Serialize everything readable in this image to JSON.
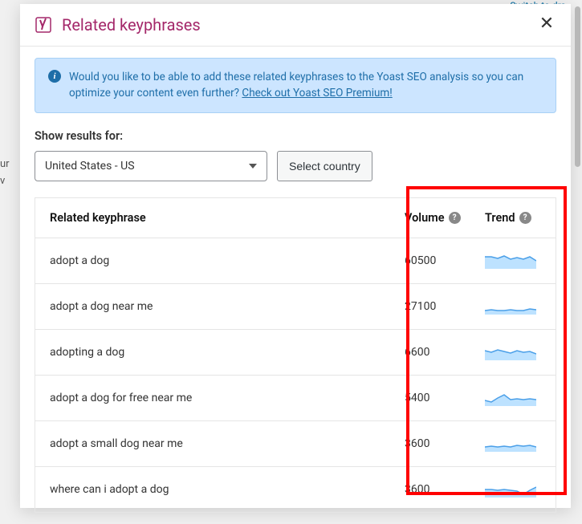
{
  "top_link": "Switch to dra",
  "modal": {
    "title": "Related keyphrases"
  },
  "banner": {
    "text": "Would you like to be able to add these related keyphrases to the Yoast SEO analysis so you can optimize your content even further? ",
    "link": "Check out Yoast SEO Premium!"
  },
  "controls": {
    "label": "Show results for:",
    "selected_country": "United States - US",
    "select_button": "Select country"
  },
  "table": {
    "headers": {
      "keyphrase": "Related keyphrase",
      "volume": "Volume",
      "trend": "Trend"
    },
    "rows": [
      {
        "key": "adopt a dog",
        "vol": "60500"
      },
      {
        "key": "adopt a dog near me",
        "vol": "27100"
      },
      {
        "key": "adopting a dog",
        "vol": "6600"
      },
      {
        "key": "adopt a dog for free near me",
        "vol": "5400"
      },
      {
        "key": "adopt a small dog near me",
        "vol": "3600"
      },
      {
        "key": "where can i adopt a dog",
        "vol": "3600"
      }
    ]
  },
  "trend_paths": [
    "M0,5 L8,5 L16,7 L24,4 L32,8 L40,6 L48,8 L56,5 L64,10",
    "M0,15 L8,14 L16,15 L24,15 L32,14 L40,15 L48,15 L56,13 L64,14",
    "M0,8 L8,10 L16,7 L24,9 L32,11 L40,8 L48,10 L56,9 L64,12",
    "M0,13 L8,15 L16,10 L24,6 L32,12 L40,11 L48,12 L56,11 L64,12",
    "M0,14 L8,13 L16,14 L24,13 L32,14 L40,12 L48,13 L56,12 L64,14",
    "M0,10 L8,10 L16,11 L24,10 L32,11 L40,12 L48,16 L56,11 L64,7"
  ],
  "background": {
    "line1": "ur",
    "line2": "v"
  }
}
